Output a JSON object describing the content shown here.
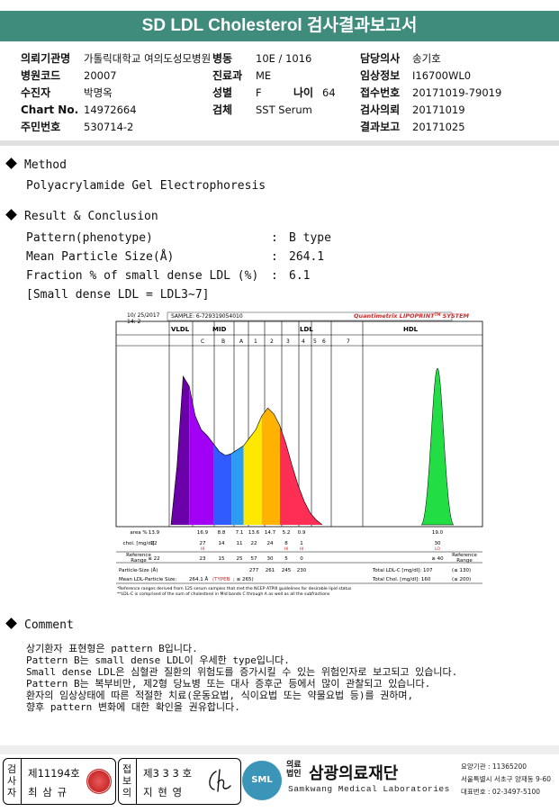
{
  "title": "SD LDL Cholesterol 검사결과보고서",
  "header": {
    "col1": [
      {
        "label": "의뢰기관명",
        "value": "가톨릭대학교 여의도성모병원"
      },
      {
        "label": "병원코드",
        "value": "20007"
      },
      {
        "label": "수진자",
        "value": "박명옥"
      },
      {
        "label": "Chart No.",
        "value": "14972664"
      },
      {
        "label": "주민번호",
        "value": "530714-2"
      }
    ],
    "col2": [
      {
        "label": "병동",
        "value": "10E / 1016"
      },
      {
        "label": "진료과",
        "value": "ME"
      },
      {
        "label": "성별",
        "value": "F"
      },
      {
        "label": "검체",
        "value": "SST Serum"
      }
    ],
    "age": {
      "label": "나이",
      "value": "64"
    },
    "col3": [
      {
        "label": "담당의사",
        "value": "송기호"
      },
      {
        "label": "임상정보",
        "value": "I16700WL0"
      },
      {
        "label": "접수번호",
        "value": "20171019-79019"
      },
      {
        "label": "검사의뢰",
        "value": "20171019"
      },
      {
        "label": "결과보고",
        "value": "20171025"
      }
    ]
  },
  "method": {
    "title": "Method",
    "text": "Polyacrylamide Gel Electrophoresis"
  },
  "result": {
    "title": "Result & Conclusion",
    "rows": [
      {
        "label": "Pattern(phenotype)",
        "sep": ":",
        "value": "B type"
      },
      {
        "label": "Mean Particle Size(Å)",
        "sep": ":",
        "value": "264.1"
      },
      {
        "label": "Fraction % of small dense LDL (%)",
        "sep": ":",
        "value": "6.1"
      }
    ],
    "note": "[Small dense LDL = LDL3~7]"
  },
  "chart_data": {
    "type": "area",
    "header_left": [
      "10/ 25/2017",
      "14: 2"
    ],
    "sample": "SAMPLE:   6-729319054010",
    "brand": "Quantimetrix LIPOPRINT",
    "brand_sup": "TM",
    "brand_tail": " SYSTEM",
    "group_labels": {
      "vldl": "VLDL",
      "mid": "MID",
      "ldl": "LDL",
      "hdl": "HDL"
    },
    "band_labels": [
      "C",
      "B",
      "A",
      "1",
      "2",
      "3",
      "4",
      "5",
      "6",
      "7"
    ],
    "colors": {
      "vldl": "#6a00a8",
      "midC": "#a100f5",
      "midB": "#2f5bff",
      "midA": "#2a9df2",
      "ldl1": "#ffe800",
      "ldl2": "#ffb300",
      "ldl3": "#ff2e55",
      "hdl": "#22dd44"
    },
    "curve": [
      [
        0,
        0
      ],
      [
        1,
        60
      ],
      [
        2,
        150
      ],
      [
        3,
        140
      ],
      [
        4,
        110
      ],
      [
        5,
        96
      ],
      [
        6,
        90
      ],
      [
        7,
        82
      ],
      [
        8,
        74
      ],
      [
        9,
        70
      ],
      [
        10,
        72
      ],
      [
        11,
        76
      ],
      [
        12,
        80
      ],
      [
        13,
        88
      ],
      [
        14,
        96
      ],
      [
        15,
        110
      ],
      [
        16,
        118
      ],
      [
        17,
        112
      ],
      [
        18,
        100
      ],
      [
        19,
        82
      ],
      [
        20,
        60
      ],
      [
        21,
        40
      ],
      [
        22,
        24
      ],
      [
        23,
        12
      ],
      [
        24,
        5
      ],
      [
        25,
        0
      ]
    ],
    "hdl_peak": 120,
    "table": {
      "area_label": "area %",
      "area": [
        "13.9",
        "16.9",
        "8.8",
        "7.1",
        "13.6",
        "14.7",
        "5.2",
        "0.9",
        "",
        "",
        "19.0"
      ],
      "chol_label": "chol. [mg/dl]",
      "chol": [
        "22",
        "27",
        "14",
        "11",
        "22",
        "24",
        "8",
        "1",
        "",
        "",
        "30"
      ],
      "flags": [
        "",
        "HI",
        "",
        "",
        "",
        "",
        "HI",
        "HI",
        "",
        "",
        "LO"
      ],
      "ref_label": [
        "Reference",
        "Range"
      ],
      "ref": [
        "≤ 22",
        "23",
        "15",
        "25",
        "57",
        "30",
        "5",
        "0",
        "",
        "",
        "≥ 40"
      ],
      "ref_right": [
        "Reference",
        "Range"
      ],
      "particle_label": "Particle-Size (Å)",
      "particle": [
        "277",
        "261",
        "245",
        "230"
      ],
      "mean_label": "Mean LDL-Particle Size:",
      "mean_value": "264.1 Å",
      "mean_type": "(TYPEB",
      "mean_tail": "; ≤ 265)",
      "total_ldl": "Total LDL-C [mg/dl]:  107",
      "total_ldl_ref": "(≤ 130)",
      "total_chol": "Total Chol. [mg/dl]:  160",
      "total_chol_ref": "(≤ 200)"
    },
    "footnotes": [
      "*Reference ranges derived from 125 serum samples that met the NCEP ATPIII guidelines for desirable lipid status",
      "**LDL-C is comprised of the sum of cholesterol in Mid bands C through A as well as all the subfractions"
    ]
  },
  "comment": {
    "title": "Comment",
    "lines": [
      "상기환자 표현형은 pattern B입니다.",
      "Pattern B는 small dense LDL이 우세한 type입니다.",
      "Small dense LDL은 심혈관 질환의 위험도를 증가시킬 수 있는 위험인자로 보고되고 있습니다.",
      "Pattern B는 복부비만, 제2형 당뇨병 또는 대사 증후군 등에서 많이 관찰되고 있습니다.",
      "환자의 임상상태에 따른 적절한 치료(운동요법, 식이요법 또는 약물요법 등)를 권하며,",
      "향후 pattern 변화에 대한 확인을 권유합니다."
    ]
  },
  "footer": {
    "box1_vertical": [
      "검",
      "사",
      "자"
    ],
    "box1_number": "제11194호",
    "box1_name": "최 삼 규",
    "box2_vertical": [
      "접",
      "보",
      "의"
    ],
    "box2_number": "제3 3 3 호",
    "box2_name": "지 현 영",
    "logo_text": "SML",
    "org_small": [
      "의료",
      "법인"
    ],
    "org_name": "삼광의료재단",
    "org_en": "Samkwang Medical Laboratories",
    "info": [
      "요양기관 : 11365200",
      "서울특별시 서초구 양재동 9-60",
      "대표번호 : 02-3497-5100"
    ]
  }
}
